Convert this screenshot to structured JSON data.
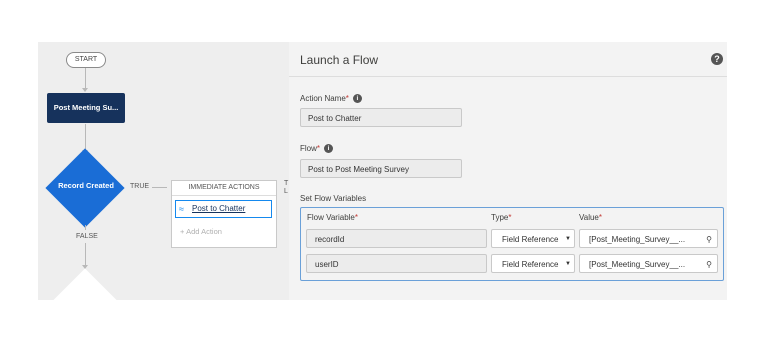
{
  "canvas": {
    "start_label": "START",
    "record_box_label": "Post Meeting Su...",
    "decision_label": "Record Created",
    "true_label": "TRUE",
    "false_label": "FALSE",
    "immediate_actions_header": "IMMEDIATE ACTIONS",
    "action_item_label": "Post to Chatter",
    "add_action_label": "Add Action",
    "cut_off_label": "T L"
  },
  "panel": {
    "title": "Launch a Flow",
    "help_icon": "question-icon",
    "action_name_label": "Action Name",
    "action_name_value": "Post to Chatter",
    "flow_label": "Flow",
    "flow_value": "Post to Post Meeting Survey",
    "set_flow_variables_label": "Set Flow Variables",
    "columns": {
      "variable": "Flow Variable",
      "type": "Type",
      "value": "Value"
    },
    "rows": [
      {
        "variable": "recordId",
        "type": "Field Reference",
        "value": "[Post_Meeting_Survey__..."
      },
      {
        "variable": "userID",
        "type": "Field Reference",
        "value": "[Post_Meeting_Survey__..."
      }
    ]
  },
  "colors": {
    "record_box": "#16325c",
    "decision": "#1a6dd6",
    "selection_border": "#1589ee",
    "required": "#c23934"
  }
}
